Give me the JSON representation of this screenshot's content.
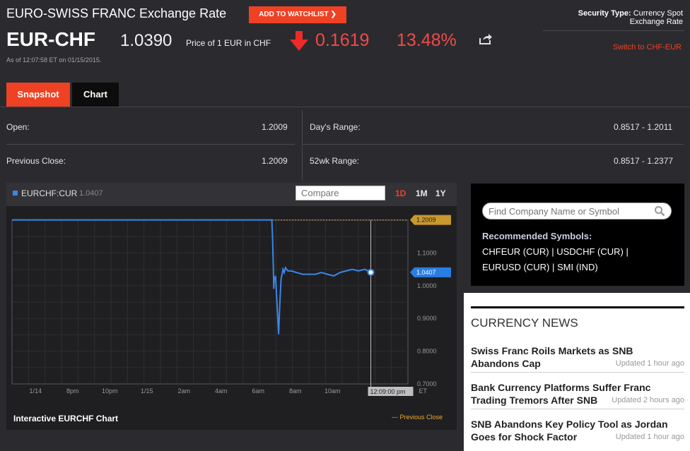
{
  "header": {
    "title": "EURO-SWISS FRANC Exchange Rate",
    "watchlist_label": "ADD TO WATCHLIST",
    "ticker": "EUR-CHF",
    "price": "1.0390",
    "price_desc": "Price of 1 EUR in CHF",
    "change": "0.1619",
    "change_pct": "13.48%",
    "as_of": "As of 12:07:58 ET on 01/15/2015.",
    "security_type_label": "Security Type:",
    "security_type_value_1": "Currency Spot",
    "security_type_value_2": "Exchange Rate",
    "switch_label": "Switch to CHF-EUR",
    "colors": {
      "accent": "#ef4123",
      "negative": "#ef4a4a"
    }
  },
  "tabs": [
    {
      "label": "Snapshot",
      "active": true
    },
    {
      "label": "Chart",
      "active": false
    }
  ],
  "stats": {
    "open_label": "Open:",
    "open_value": "1.2009",
    "prev_close_label": "Previous Close:",
    "prev_close_value": "1.2009",
    "days_range_label": "Day's Range:",
    "days_range_value": "0.8517 - 1.2011",
    "wk52_range_label": "52wk Range:",
    "wk52_range_value": "0.8517 - 1.2377"
  },
  "chart": {
    "symbol": "EURCHF:CUR",
    "symbol_value": "1.0407",
    "compare_placeholder": "Compare",
    "ranges": [
      "1D",
      "1M",
      "1Y"
    ],
    "active_range": "1D",
    "footer_title": "Interactive EURCHF Chart",
    "footer_legend": "--- Previous Close",
    "crosshair_label": "12:09:00 pm",
    "tz_label": "ET",
    "prev_close_tag": "1.2009",
    "last_tag": "1.0407"
  },
  "chart_data": {
    "type": "line",
    "x_ticks": [
      "1/14",
      "8pm",
      "10pm",
      "1/15",
      "2am",
      "4am",
      "6am",
      "8am",
      "10am"
    ],
    "y_ticks": [
      "1.1000",
      "1.0000",
      "0.9000",
      "0.8000",
      "0.7000"
    ],
    "ylim": [
      0.7,
      1.2
    ],
    "grid": true,
    "series": [
      {
        "name": "EURCHF:CUR",
        "color": "#3a86e8",
        "points": [
          [
            0,
            1.2009
          ],
          [
            2.0,
            1.2009
          ],
          [
            4.0,
            1.2009
          ],
          [
            6.0,
            1.2009
          ],
          [
            8.0,
            1.2009
          ],
          [
            10.0,
            1.2009
          ],
          [
            12.0,
            1.2009
          ],
          [
            14.0,
            1.2009
          ],
          [
            16.0,
            1.2009
          ],
          [
            18.0,
            1.2009
          ],
          [
            20.0,
            1.2009
          ],
          [
            21.0,
            1.2009
          ],
          [
            21.06,
            1.15
          ],
          [
            21.12,
            1.06
          ],
          [
            21.16,
            0.99
          ],
          [
            21.2,
            1.02
          ],
          [
            21.3,
            1.03
          ],
          [
            21.45,
            0.92
          ],
          [
            21.55,
            0.8517
          ],
          [
            21.65,
            0.95
          ],
          [
            21.75,
            1.02
          ],
          [
            21.9,
            1.05
          ],
          [
            22.0,
            1.04
          ],
          [
            22.1,
            1.055
          ],
          [
            22.3,
            1.045
          ],
          [
            22.6,
            1.045
          ],
          [
            23.0,
            1.04
          ],
          [
            23.5,
            1.035
          ],
          [
            24.0,
            1.035
          ],
          [
            24.5,
            1.035
          ],
          [
            25.0,
            1.04
          ],
          [
            25.5,
            1.035
          ],
          [
            26.0,
            1.03
          ],
          [
            26.5,
            1.04
          ],
          [
            27.0,
            1.045
          ],
          [
            27.5,
            1.05
          ],
          [
            28.0,
            1.045
          ],
          [
            28.5,
            1.05
          ],
          [
            29.0,
            1.0407
          ]
        ]
      }
    ],
    "previous_close": 1.2009,
    "last_value": 1.0407
  },
  "search": {
    "placeholder": "Find Company Name or Symbol",
    "recommended_title": "Recommended Symbols:",
    "symbols": [
      "CHFEUR (CUR)",
      "USDCHF (CUR)",
      "EURUSD (CUR)",
      "SMI (IND)"
    ]
  },
  "news": {
    "title": "CURRENCY NEWS",
    "items": [
      {
        "headline_1": "Swiss Franc Roils Markets as SNB",
        "headline_2": "Abandons Cap",
        "time": "Updated 1 hour ago"
      },
      {
        "headline_1": "Bank Currency Platforms Suffer Franc",
        "headline_2": "Trading Tremors After SNB",
        "time": "Updated 2 hours ago"
      },
      {
        "headline_1": "SNB Abandons Key Policy Tool as Jordan",
        "headline_2": "Goes for Shock Factor",
        "time": "Updated 1 hour ago"
      }
    ]
  }
}
